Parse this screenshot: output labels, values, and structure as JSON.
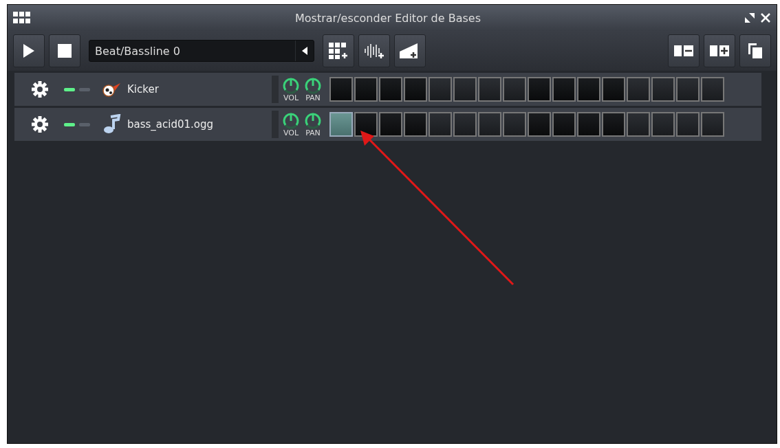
{
  "window": {
    "title": "Mostrar/esconder Editor de Bases"
  },
  "toolbar": {
    "pattern": "Beat/Bassline 0"
  },
  "tracks": [
    {
      "name": "Kicker",
      "kind": "drum",
      "muted": false,
      "solo": false,
      "knob_labels": [
        "VOL",
        "PAN"
      ],
      "steps": [
        false,
        false,
        false,
        false,
        false,
        false,
        false,
        false,
        false,
        false,
        false,
        false,
        false,
        false,
        false,
        false
      ]
    },
    {
      "name": "bass_acid01.ogg",
      "kind": "sample",
      "muted": false,
      "solo": false,
      "knob_labels": [
        "VOL",
        "PAN"
      ],
      "steps": [
        true,
        false,
        false,
        false,
        false,
        false,
        false,
        false,
        false,
        false,
        false,
        false,
        false,
        false,
        false,
        false
      ]
    }
  ]
}
